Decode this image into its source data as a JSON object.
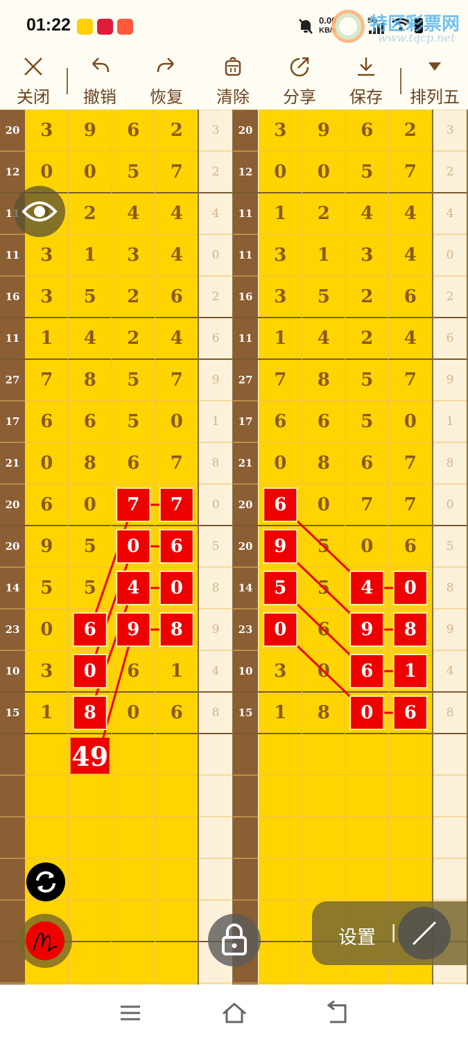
{
  "status_bar": {
    "time": "01:22",
    "net_speed_top": "0.00",
    "net_speed_unit": "KB/s",
    "signal_label": "5G",
    "watermark_title": "特区彩票网",
    "watermark_url": "www.tqcp.net"
  },
  "toolbar": {
    "close_label": "关闭",
    "undo_label": "撤销",
    "redo_label": "恢复",
    "clear_label": "清除",
    "share_label": "分享",
    "save_label": "保存",
    "mode_label": "排列五"
  },
  "board": {
    "rows": [
      {
        "sum": "20",
        "digits": [
          "3",
          "9",
          "6",
          "2"
        ],
        "last": "3"
      },
      {
        "sum": "12",
        "digits": [
          "0",
          "0",
          "5",
          "7"
        ],
        "last": "2"
      },
      {
        "sum": "11",
        "digits": [
          "1",
          "2",
          "4",
          "4"
        ],
        "last": "4"
      },
      {
        "sum": "11",
        "digits": [
          "3",
          "1",
          "3",
          "4"
        ],
        "last": "0"
      },
      {
        "sum": "16",
        "digits": [
          "3",
          "5",
          "2",
          "6"
        ],
        "last": "2"
      },
      {
        "sum": "11",
        "digits": [
          "1",
          "4",
          "2",
          "4"
        ],
        "last": "6"
      },
      {
        "sum": "27",
        "digits": [
          "7",
          "8",
          "5",
          "7"
        ],
        "last": "9"
      },
      {
        "sum": "17",
        "digits": [
          "6",
          "6",
          "5",
          "0"
        ],
        "last": "1"
      },
      {
        "sum": "21",
        "digits": [
          "0",
          "8",
          "6",
          "7"
        ],
        "last": "8"
      },
      {
        "sum": "20",
        "digits": [
          "6",
          "0",
          "7",
          "7"
        ],
        "last": "0"
      },
      {
        "sum": "20",
        "digits": [
          "9",
          "5",
          "0",
          "6"
        ],
        "last": "5"
      },
      {
        "sum": "14",
        "digits": [
          "5",
          "5",
          "4",
          "0"
        ],
        "last": "8"
      },
      {
        "sum": "23",
        "digits": [
          "0",
          "6",
          "9",
          "8"
        ],
        "last": "9"
      },
      {
        "sum": "10",
        "digits": [
          "3",
          "0",
          "6",
          "1"
        ],
        "last": "4"
      },
      {
        "sum": "15",
        "digits": [
          "1",
          "8",
          "0",
          "6"
        ],
        "last": "8"
      }
    ],
    "left_marks": [
      {
        "row": 9,
        "col": 2
      },
      {
        "row": 9,
        "col": 3
      },
      {
        "row": 10,
        "col": 2
      },
      {
        "row": 10,
        "col": 3
      },
      {
        "row": 11,
        "col": 2
      },
      {
        "row": 11,
        "col": 3
      },
      {
        "row": 12,
        "col": 1
      },
      {
        "row": 12,
        "col": 2
      },
      {
        "row": 12,
        "col": 3
      },
      {
        "row": 13,
        "col": 1
      },
      {
        "row": 14,
        "col": 1
      }
    ],
    "right_marks": [
      {
        "row": 9,
        "col": 0
      },
      {
        "row": 10,
        "col": 0
      },
      {
        "row": 11,
        "col": 0
      },
      {
        "row": 12,
        "col": 0
      },
      {
        "row": 11,
        "col": 2
      },
      {
        "row": 11,
        "col": 3
      },
      {
        "row": 12,
        "col": 2
      },
      {
        "row": 12,
        "col": 3
      },
      {
        "row": 13,
        "col": 2
      },
      {
        "row": 13,
        "col": 3
      },
      {
        "row": 14,
        "col": 2
      },
      {
        "row": 14,
        "col": 3
      }
    ],
    "annotation_value": "49"
  },
  "floating": {
    "settings_label": "设置",
    "settings_divider": "|"
  },
  "colors": {
    "background": "#fffdf3",
    "board_yellow": "#ffd400",
    "board_brown": "#8b5e34",
    "digit_brown": "#8a5a1c",
    "mark_red": "#ee0000",
    "pale_column": "#fbf1d8"
  },
  "icons": {
    "close": "close-icon",
    "undo": "undo-icon",
    "redo": "redo-icon",
    "clear": "trash-icon",
    "share": "share-icon",
    "save": "download-icon",
    "mode": "triangle-down-icon",
    "eye": "eye-icon",
    "refresh": "refresh-icon",
    "pen": "pen-icon",
    "lock": "lock-icon",
    "line": "line-tool-icon"
  }
}
